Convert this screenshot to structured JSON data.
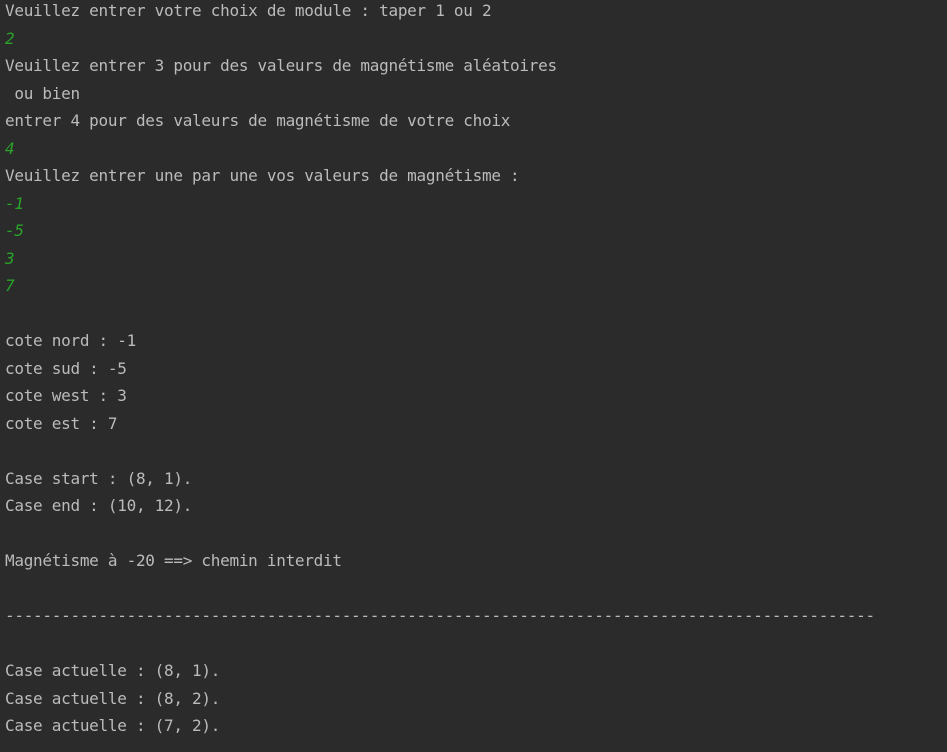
{
  "console": {
    "lines": [
      {
        "type": "out",
        "text": "Veuillez entrer votre choix de module : taper 1 ou 2"
      },
      {
        "type": "in",
        "text": "2"
      },
      {
        "type": "out",
        "text": "Veuillez entrer 3 pour des valeurs de magnétisme aléatoires"
      },
      {
        "type": "out",
        "text": " ou bien"
      },
      {
        "type": "out",
        "text": "entrer 4 pour des valeurs de magnétisme de votre choix"
      },
      {
        "type": "in",
        "text": "4"
      },
      {
        "type": "out",
        "text": "Veuillez entrer une par une vos valeurs de magnétisme :"
      },
      {
        "type": "in",
        "text": "-1"
      },
      {
        "type": "in",
        "text": "-5"
      },
      {
        "type": "in",
        "text": "3"
      },
      {
        "type": "in",
        "text": "7"
      },
      {
        "type": "blank",
        "text": ""
      },
      {
        "type": "out",
        "text": "cote nord : -1"
      },
      {
        "type": "out",
        "text": "cote sud : -5"
      },
      {
        "type": "out",
        "text": "cote west : 3"
      },
      {
        "type": "out",
        "text": "cote est : 7"
      },
      {
        "type": "blank",
        "text": ""
      },
      {
        "type": "out",
        "text": "Case start : (8, 1)."
      },
      {
        "type": "out",
        "text": "Case end : (10, 12)."
      },
      {
        "type": "blank",
        "text": ""
      },
      {
        "type": "out",
        "text": "Magnétisme à -20 ==> chemin interdit"
      },
      {
        "type": "blank",
        "text": ""
      },
      {
        "type": "out",
        "text": "---------------------------------------------------------------------------------------------"
      },
      {
        "type": "blank",
        "text": ""
      },
      {
        "type": "out",
        "text": "Case actuelle : (8, 1)."
      },
      {
        "type": "out",
        "text": "Case actuelle : (8, 2)."
      },
      {
        "type": "out",
        "text": "Case actuelle : (7, 2)."
      }
    ]
  },
  "colors": {
    "background": "#2b2b2b",
    "output_text": "#bbbbbb",
    "user_input_text": "#29a329"
  }
}
